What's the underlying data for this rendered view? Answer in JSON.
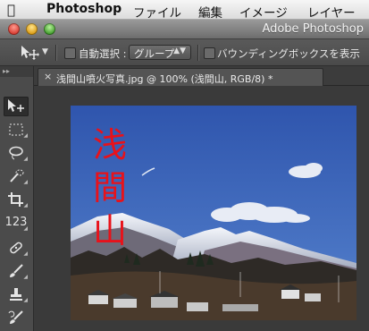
{
  "menubar": {
    "apple_icon": "apple-logo",
    "app_name": "Photoshop",
    "items": [
      "ファイル",
      "編集",
      "イメージ",
      "レイヤー"
    ]
  },
  "window": {
    "title": "Adobe Photoshop"
  },
  "options_bar": {
    "tool_icon": "move-tool-icon",
    "auto_select_label": "自動選択 :",
    "auto_select_value": "グループ",
    "show_bounding_label": "バウンディングボックスを表示"
  },
  "tabs": [
    {
      "close": "×",
      "label": "浅間山噴火写真.jpg @ 100% (浅間山, RGB/8) *"
    }
  ],
  "photo": {
    "overlay_text": [
      "浅",
      "間",
      "山"
    ],
    "overlay_color": "#e8121a",
    "sky_color": "#3a63b5"
  },
  "tools": [
    "move-tool-icon",
    "marquee-tool-icon",
    "lasso-tool-icon",
    "quick-select-tool-icon",
    "crop-tool-icon",
    "eyedropper-tool-icon",
    "healing-brush-tool-icon",
    "brush-tool-icon",
    "clone-stamp-tool-icon",
    "history-brush-tool-icon"
  ],
  "tool_counter_label": "123"
}
